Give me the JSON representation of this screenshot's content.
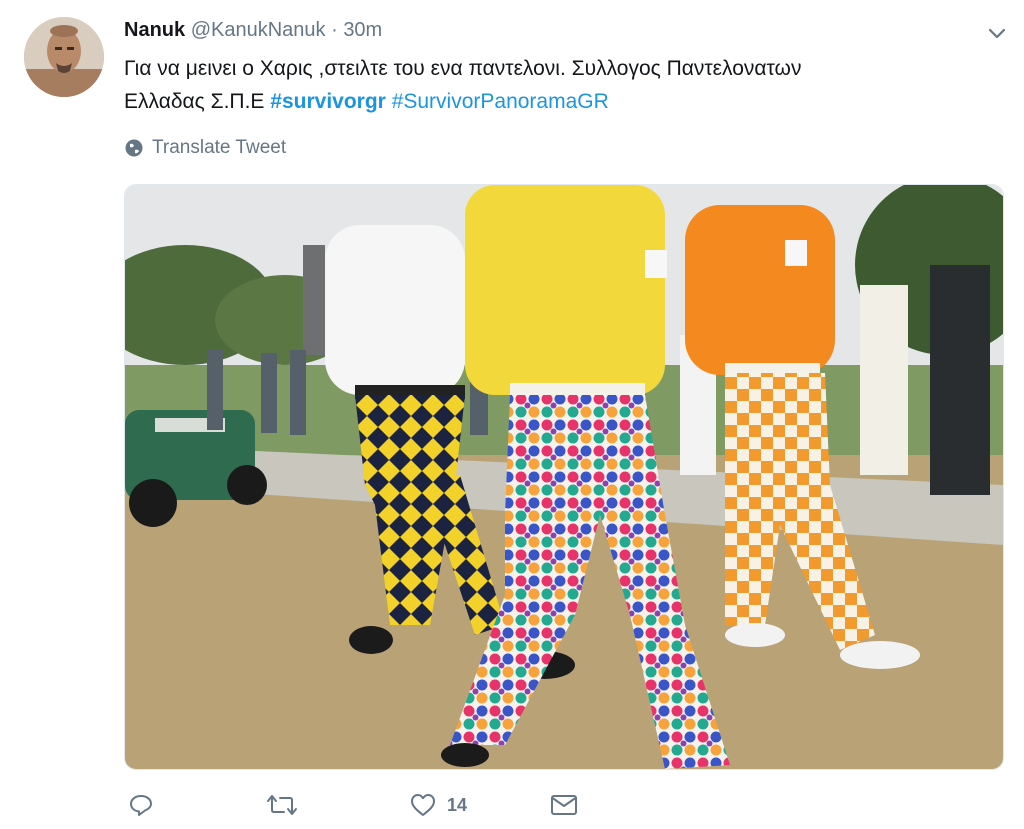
{
  "tweet": {
    "author_name": "Nanuk",
    "handle": "@KanukNanuk",
    "separator": "·",
    "time": "30m",
    "text_line1": "Για να μεινει ο Χαρις ,στειλτε του ενα παντελονι. Συλλογος Παντελονατων",
    "text_line2_prefix": "Ελλαδας  Σ.Π.Ε ",
    "hashtag1": "#survivorgr",
    "hashtag2": "#SurvivorPanoramaGR",
    "translate_label": "Translate Tweet",
    "like_count": "14"
  },
  "icons": {
    "reply": "reply-icon",
    "retweet": "retweet-icon",
    "like": "heart-icon",
    "dm": "envelope-icon",
    "menu": "chevron-down-icon",
    "globe": "globe-icon"
  },
  "colors": {
    "link": "#1b95e0",
    "muted": "#657786",
    "text": "#14171a"
  }
}
